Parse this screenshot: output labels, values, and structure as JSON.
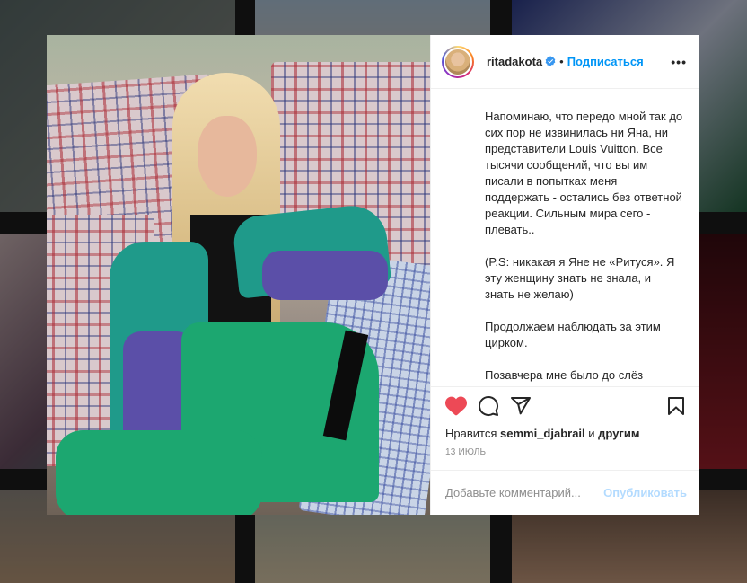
{
  "post": {
    "username": "ritadakota",
    "separator": "•",
    "follow_label": "Подписаться",
    "more_label": "•••",
    "caption_paragraphs": [
      "Напоминаю, что передо мной так до сих пор не извинилась ни Яна, ни представители Louis Vuitton. Все тысячи сообщений, что вы им писали в попытках меня поддержать - остались без ответной реакции. Сильным мира сего - плевать..",
      "(P.S: никакая я Яне не «Ритуся». Я эту женщину знать не знала, и знать не желаю)",
      "Продолжаем наблюдать за этим цирком.",
      "Позавчера мне было до слёз обидно и больно, вчера смешно, а сегодня тошно. Так тошно, что охота помыться."
    ],
    "likes_prefix": "Нравится",
    "likes_user": "semmi_djabrail",
    "likes_and": "и",
    "likes_others": "другим",
    "date": "13 ИЮЛЬ",
    "comment_placeholder": "Добавьте комментарий...",
    "publish_label": "Опубликовать",
    "icons": [
      "heart-icon",
      "comment-icon",
      "share-icon",
      "bookmark-icon",
      "verified-icon"
    ]
  },
  "colors": {
    "accent": "#0095f6",
    "heart": "#ed4956",
    "publish_disabled": "#b3dbff",
    "muted": "#8e8e8e"
  }
}
